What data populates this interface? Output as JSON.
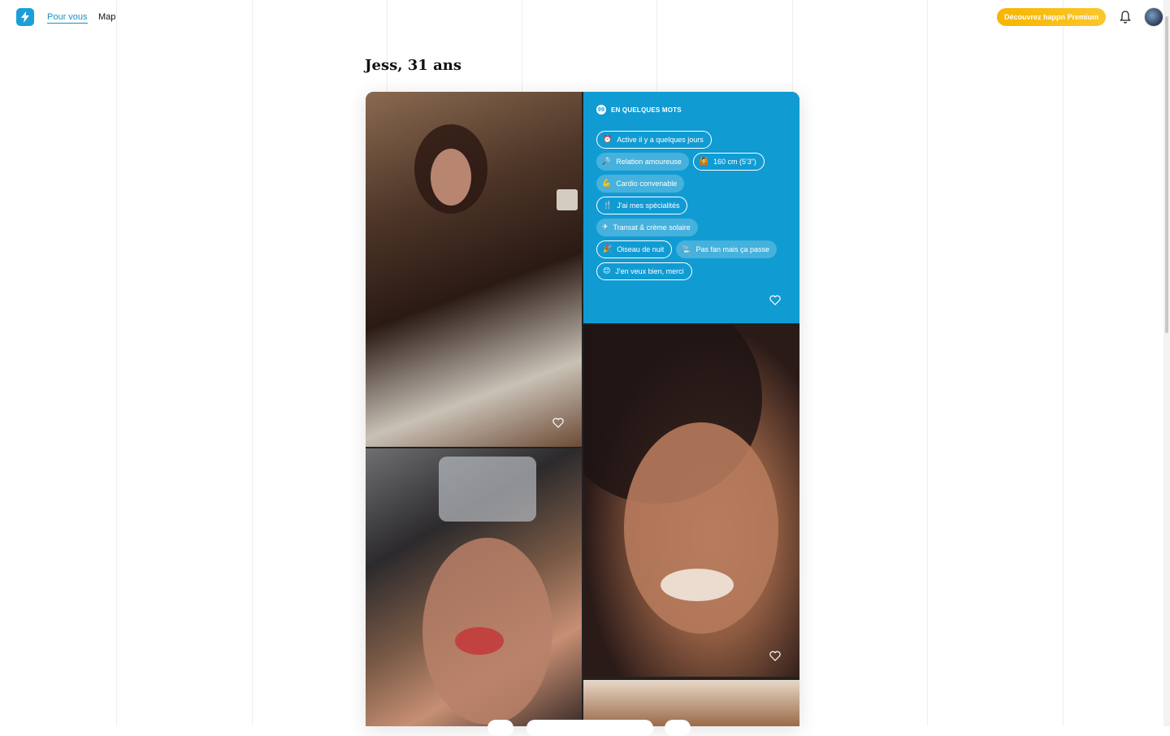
{
  "nav": {
    "tab_for_you": "Pour vous",
    "tab_map": "Map",
    "premium_button": "Découvrez happn Premium"
  },
  "profile": {
    "title": "Jess, 31 ans"
  },
  "bio": {
    "heading": "EN QUELQUES MOTS",
    "chips": [
      {
        "icon": "⏰",
        "label": "Active il y a quelques jours",
        "style": "outline"
      },
      {
        "icon": "🔎",
        "label": "Relation amoureuse",
        "style": "filled"
      },
      {
        "icon": "🙆",
        "label": "160 cm (5'3\")",
        "style": "outline"
      },
      {
        "icon": "💪",
        "label": "Cardio convenable",
        "style": "filled"
      },
      {
        "icon": "🍴",
        "label": "J'ai mes spécialités",
        "style": "outline"
      },
      {
        "icon": "✈",
        "label": "Transat & crème solaire",
        "style": "filled"
      },
      {
        "icon": "🎉",
        "label": "Oiseau de nuit",
        "style": "outline"
      },
      {
        "icon": "🚬",
        "label": "Pas fan mais ça passe",
        "style": "filled"
      },
      {
        "icon": "😊",
        "label": "J'en veux bien, merci",
        "style": "outline"
      }
    ]
  },
  "colors": {
    "brand": "#1a9fd8",
    "bio_background": "#119bd3",
    "premium_gold": "#f6b500"
  },
  "icons": {
    "logo": "happn-logo-icon",
    "bell": "bell-icon",
    "heart": "heart-icon"
  }
}
